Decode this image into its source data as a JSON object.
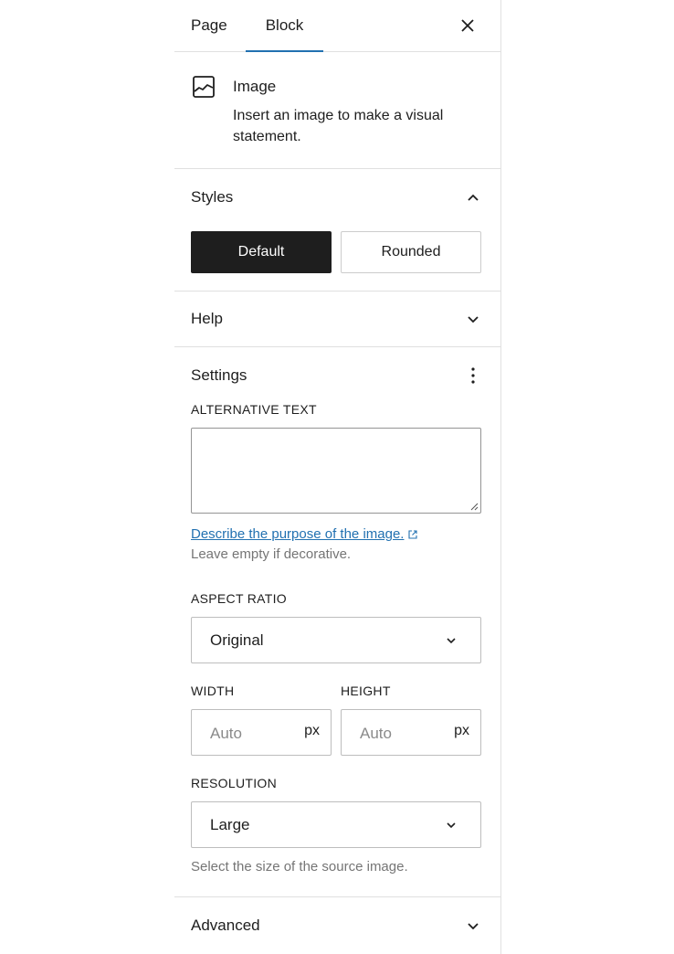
{
  "sidebar": {
    "tabs": [
      {
        "label": "Page",
        "active": false
      },
      {
        "label": "Block",
        "active": true
      }
    ],
    "close_icon": "close-icon",
    "accent_color": "#2271b1"
  },
  "block": {
    "icon": "image-icon",
    "title": "Image",
    "description": "Insert an image to make a visual statement."
  },
  "styles": {
    "title": "Styles",
    "expanded": true,
    "options": [
      {
        "label": "Default",
        "selected": true
      },
      {
        "label": "Rounded",
        "selected": false
      }
    ]
  },
  "help": {
    "title": "Help",
    "expanded": false
  },
  "settings": {
    "title": "Settings",
    "menu_icon": "more-vertical-icon",
    "alt_text": {
      "label": "ALTERNATIVE TEXT",
      "value": "",
      "link_text": "Describe the purpose of the image.",
      "hint": "Leave empty if decorative."
    },
    "aspect_ratio": {
      "label": "ASPECT RATIO",
      "value": "Original"
    },
    "width": {
      "label": "WIDTH",
      "placeholder": "Auto",
      "unit": "px"
    },
    "height": {
      "label": "HEIGHT",
      "placeholder": "Auto",
      "unit": "px"
    },
    "resolution": {
      "label": "RESOLUTION",
      "value": "Large",
      "hint": "Select the size of the source image."
    }
  },
  "advanced": {
    "title": "Advanced",
    "expanded": false
  }
}
